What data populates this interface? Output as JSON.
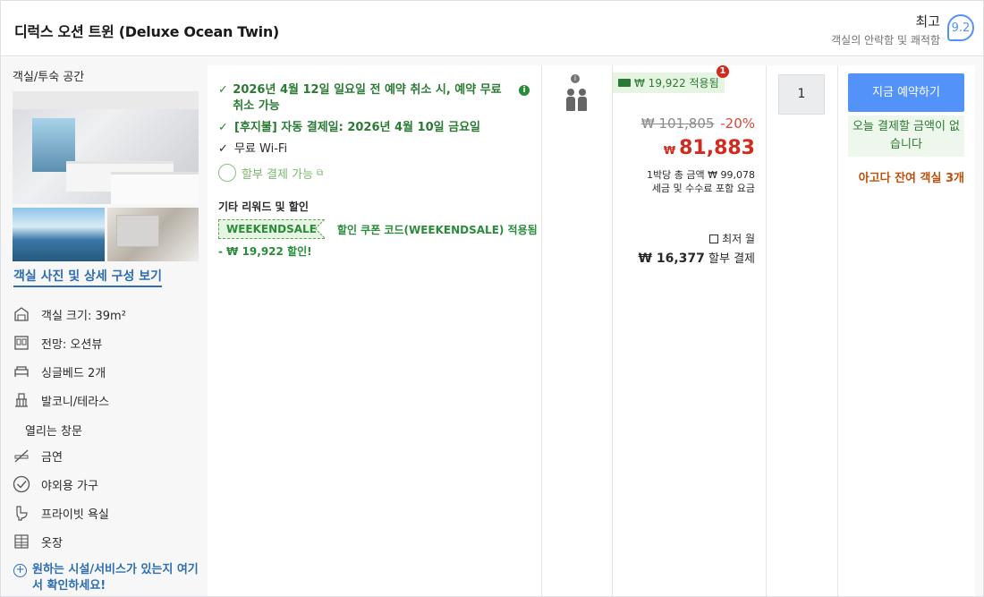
{
  "header": {
    "title": "디럭스 오션 트윈 (Deluxe Ocean Twin)",
    "rating_word": "최고",
    "rating_sub": "객실의 안락함 및 쾌적함",
    "rating_score": "9.2"
  },
  "room_panel": {
    "title": "객실/투숙 공간",
    "photo_link": "객실 사진 및 상세 구성 보기",
    "features": [
      {
        "icon": "room-size-icon",
        "label": "객실 크기: 39m²"
      },
      {
        "icon": "window-view-icon",
        "label": "전망: 오션뷰"
      },
      {
        "icon": "bed-icon",
        "label": "싱글베드 2개"
      },
      {
        "icon": "balcony-icon",
        "label": "발코니/테라스"
      },
      {
        "icon": "",
        "label": "열리는 창문"
      },
      {
        "icon": "no-smoking-icon",
        "label": "금연"
      },
      {
        "icon": "checkmark-circle-icon",
        "label": "야외용 가구"
      },
      {
        "icon": "toilet-icon",
        "label": "프라이빗 욕실"
      },
      {
        "icon": "wardrobe-icon",
        "label": "옷장"
      }
    ],
    "ask_link": "원하는 시설/서비스가 있는지 여기서 확인하세요!"
  },
  "benefits": {
    "cancel": "2026년 4월 12일 일요일 전 예약 취소 시, 예약 무료 취소 가능",
    "paylater": "[후지불] 자동 결제일: 2026년 4월 10일 금요일",
    "wifi": "무료 Wi-Fi",
    "installment": "할부 결제 가능",
    "other_title": "기타 리워드 및 할인",
    "promo_code": "WEEKENDSALE",
    "promo_text": "할인 쿠폰 코드(WEEKENDSALE) 적용됨",
    "promo_discount": "- ₩ 19,922 할인!"
  },
  "price": {
    "applied": "₩ 19,922 적용됨",
    "notification_count": "1",
    "original": "₩ 101,805",
    "discount_pct": "-20%",
    "currency": "₩",
    "final": "81,883",
    "per_night": "1박당 총 금액 ₩ 99,078",
    "tax_note": "세금 및 수수료 포함 요금",
    "monthly_label": "최저 월",
    "monthly_amount": "₩ 16,377",
    "monthly_suffix": "할부 결제"
  },
  "quantity": "1",
  "booking": {
    "book_label": "지금 예약하기",
    "pay_today": "오늘 결제할 금액이 없습니다",
    "rooms_left": "아고다 잔여 객실 3개"
  },
  "colors": {
    "accent": "#5392f9",
    "price_red": "#d12b20",
    "green": "#2a7a33",
    "urgency": "#c0500a"
  }
}
